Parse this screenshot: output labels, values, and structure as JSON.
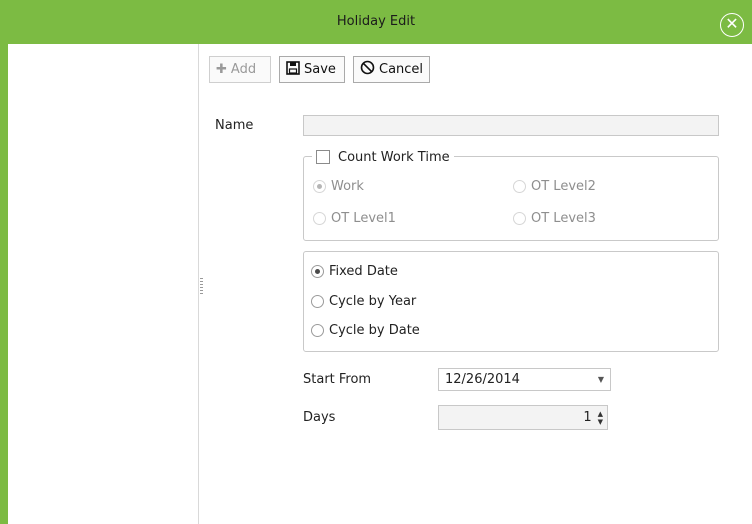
{
  "window": {
    "title": "Holiday Edit",
    "accent_color": "#7cbb43"
  },
  "toolbar": {
    "add_label": "Add",
    "save_label": "Save",
    "cancel_label": "Cancel"
  },
  "form": {
    "name_label": "Name",
    "name_value": "",
    "count_work_time": {
      "label": "Count Work Time",
      "checked": false
    },
    "work_type_options": [
      {
        "label": "Work",
        "selected": true,
        "enabled": false
      },
      {
        "label": "OT Level2",
        "selected": false,
        "enabled": false
      },
      {
        "label": "OT Level1",
        "selected": false,
        "enabled": false
      },
      {
        "label": "OT Level3",
        "selected": false,
        "enabled": false
      }
    ],
    "date_mode_options": [
      {
        "label": "Fixed Date",
        "selected": true
      },
      {
        "label": "Cycle by Year",
        "selected": false
      },
      {
        "label": "Cycle by Date",
        "selected": false
      }
    ],
    "start_from_label": "Start From",
    "start_from_value": "12/26/2014",
    "days_label": "Days",
    "days_value": "1"
  },
  "icons": {
    "close": "circle-x-icon",
    "add": "plus-icon",
    "save": "floppy-disk-icon",
    "cancel": "no-entry-icon"
  }
}
